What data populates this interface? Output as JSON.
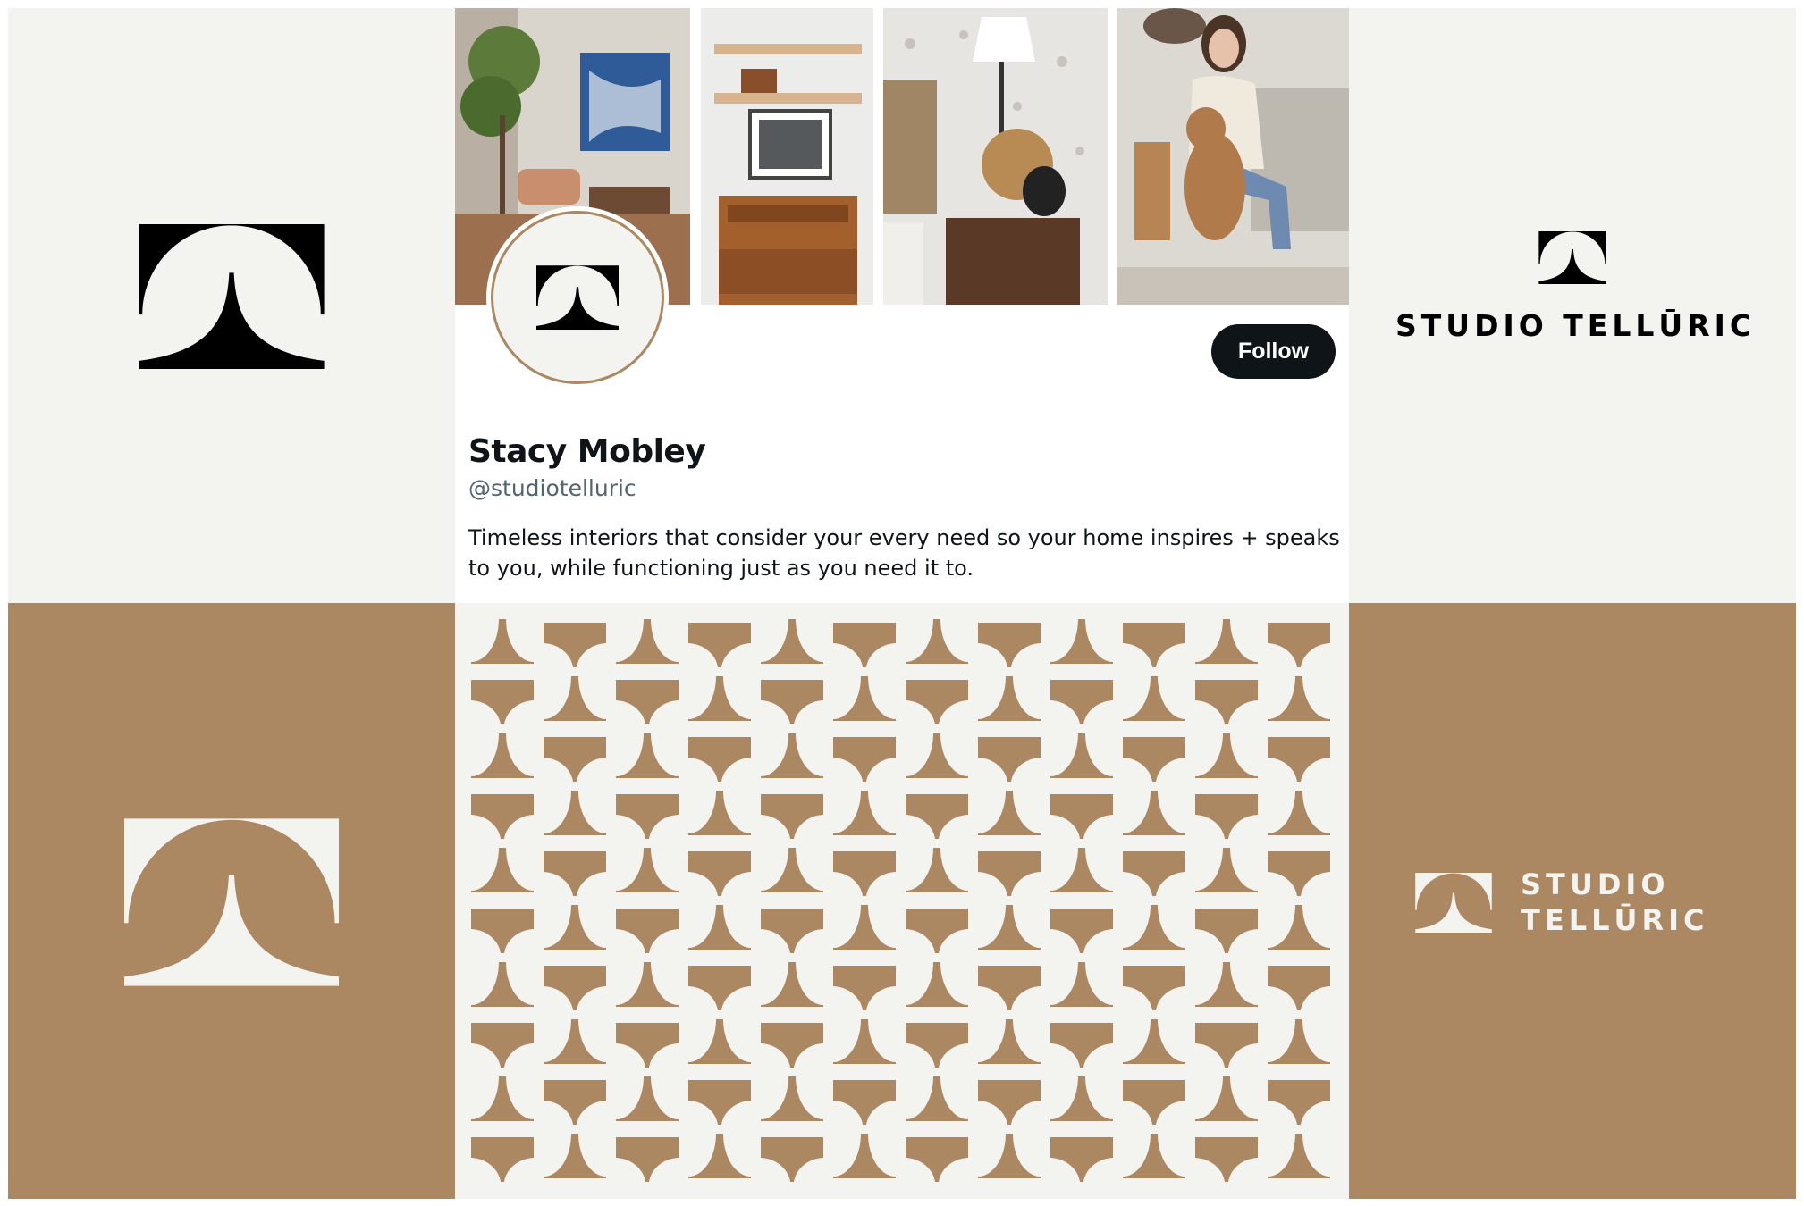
{
  "brand": {
    "wordmark_line": "STUDIO TELLŪRIC",
    "wordmark_line1": "STUDIO",
    "wordmark_line2": "TELLŪRIC"
  },
  "profile": {
    "name": "Stacy Mobley",
    "handle": "@studiotelluric",
    "bio": "Timeless interiors that consider your every need so your home inspires + speaks to you, while functioning just as you need it to.",
    "follow_label": "Follow"
  },
  "colors": {
    "cream": "#f3f3ef",
    "tan": "#ab8762",
    "black": "#0f1419",
    "avatar_ring": "#ab8762"
  },
  "icons": [
    "telluric-mark-icon"
  ]
}
